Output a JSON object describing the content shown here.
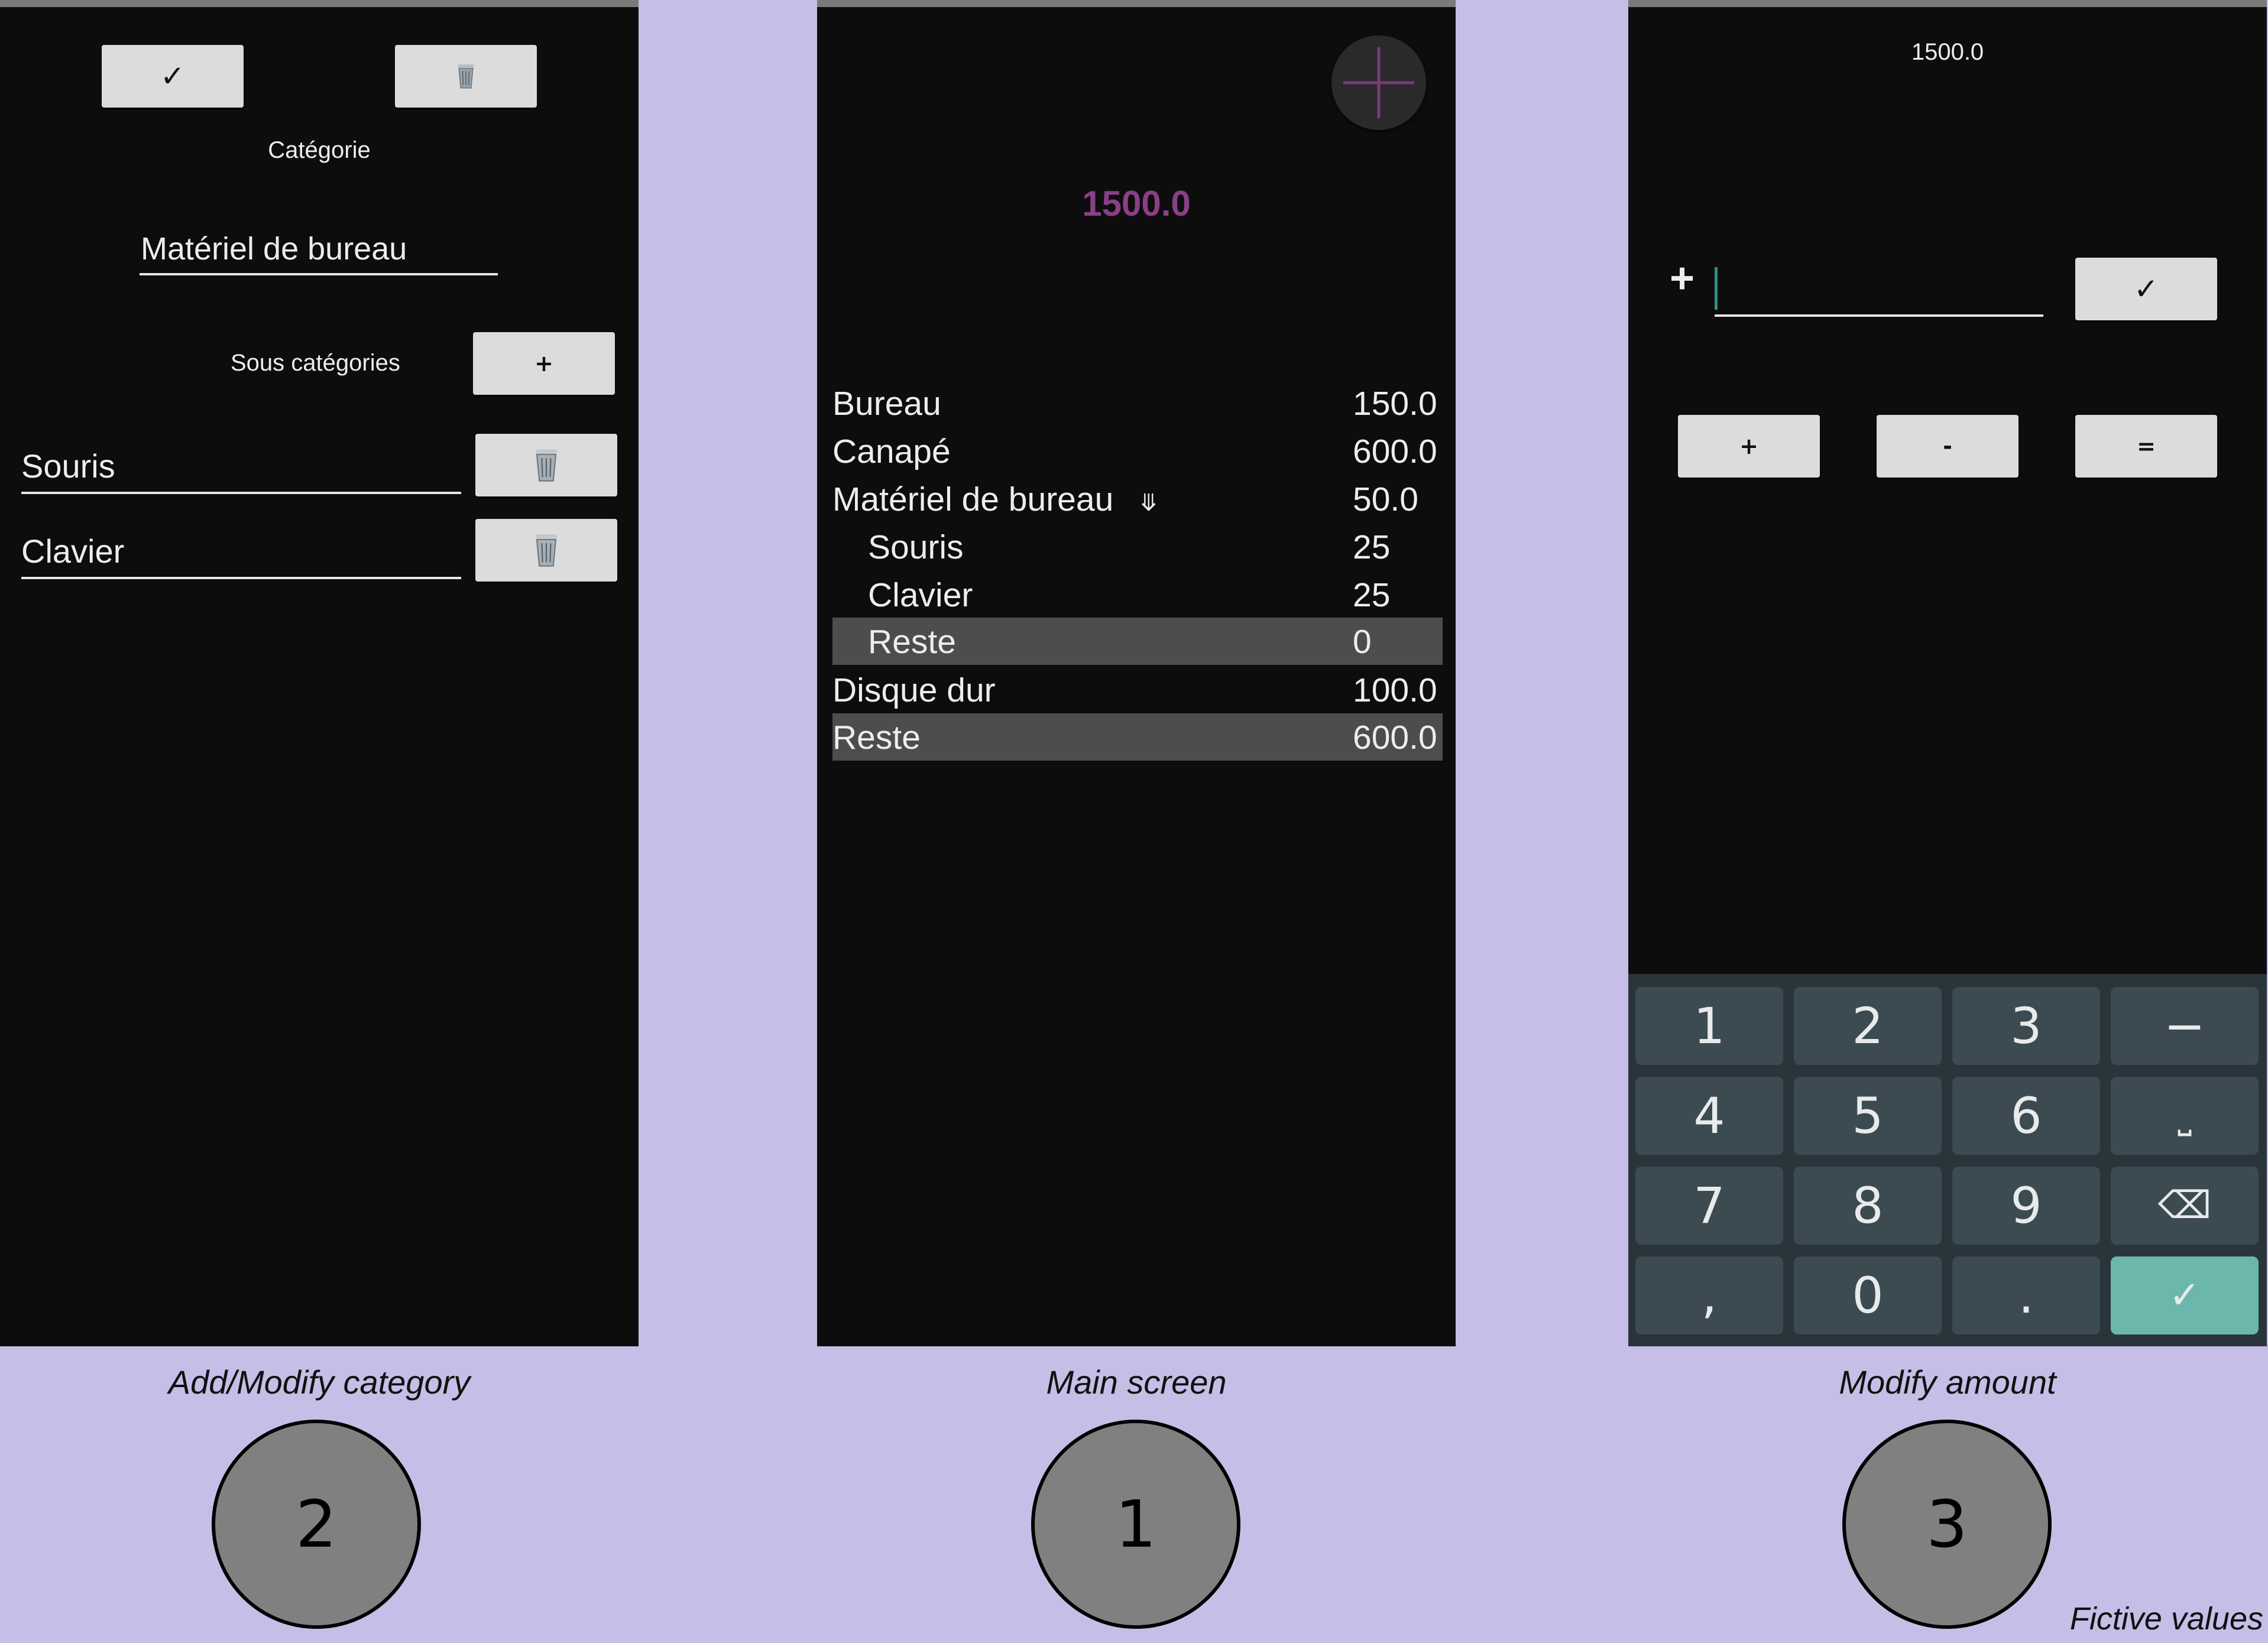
{
  "screen2": {
    "confirm_label": "✓",
    "category_label": "Catégorie",
    "category_value": "Matériel de bureau",
    "subcategories_label": "Sous catégories",
    "add_label": "+",
    "subcategories": [
      "Souris",
      "Clavier"
    ]
  },
  "screen1": {
    "total": "1500.0",
    "rows": [
      {
        "name": "Bureau",
        "value": "150.0"
      },
      {
        "name": "Canapé",
        "value": "600.0"
      },
      {
        "name": "Matériel de bureau",
        "value": "50.0"
      },
      {
        "name": "Souris",
        "value": "25"
      },
      {
        "name": "Clavier",
        "value": "25"
      },
      {
        "name": "Reste",
        "value": "0"
      },
      {
        "name": "Disque dur",
        "value": "100.0"
      },
      {
        "name": "Reste",
        "value": "600.0"
      }
    ],
    "expand_glyph": "⤋"
  },
  "screen3": {
    "total": "1500.0",
    "sign": "+",
    "amount_value": "",
    "confirm_label": "✓",
    "op_plus": "+",
    "op_minus": "-",
    "op_equals": "=",
    "keys": {
      "k1": "1",
      "k2": "2",
      "k3": "3",
      "kminus": "−",
      "k4": "4",
      "k5": "5",
      "k6": "6",
      "kspace": "⎵",
      "k7": "7",
      "k8": "8",
      "k9": "9",
      "kback": "⌫",
      "kcomma": ",",
      "k0": "0",
      "kdot": ".",
      "kok": "✓"
    }
  },
  "captions": {
    "screen2": "Add/Modify category",
    "screen1": "Main screen",
    "screen3": "Modify amount",
    "badge2": "2",
    "badge1": "1",
    "badge3": "3",
    "note": "Fictive values"
  },
  "colors": {
    "background": "#c6bee6",
    "panel": "#0d0d0e",
    "total_accent": "#8a3f86",
    "key_ok": "#6cb7ab"
  }
}
